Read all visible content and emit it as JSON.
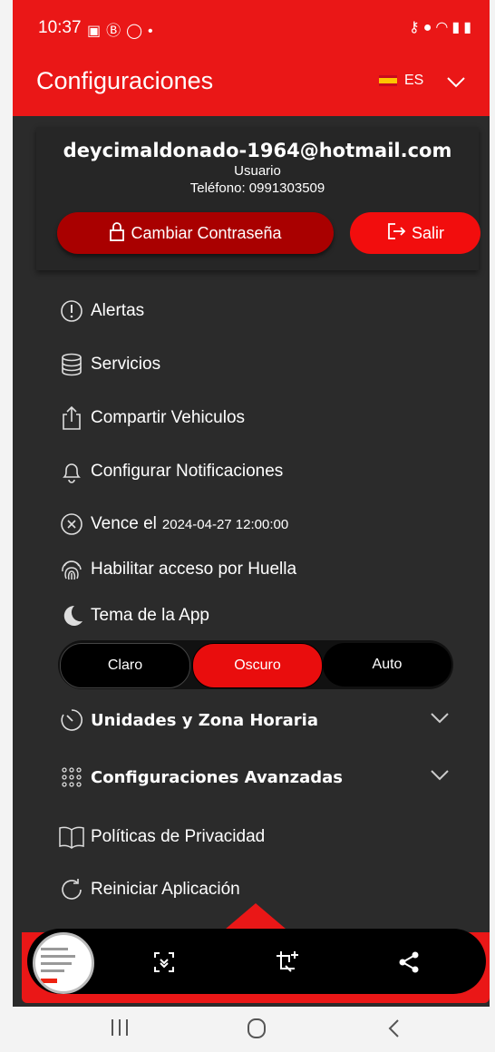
{
  "status": {
    "time": "10:37",
    "left_icons": [
      "gallery-icon",
      "b-icon",
      "whatsapp-icon",
      "dot-icon"
    ],
    "right_icons": [
      "key-icon",
      "location-icon",
      "wifi-icon",
      "lte-icon",
      "signal-icon",
      "battery-icon"
    ]
  },
  "header": {
    "title": "Configuraciones",
    "lang": "ES"
  },
  "user": {
    "email": "deycimaldonado-1964@hotmail.com",
    "role": "Usuario",
    "phone": "Teléfono: 0991303509",
    "change_password": "Cambiar Contraseña",
    "logout": "Salir"
  },
  "menu": {
    "alerts": "Alertas",
    "services": "Servicios",
    "share": "Compartir Vehiculos",
    "notifications": "Configurar Notificaciones",
    "expires_label": "Vence el",
    "expires_value": "2024-04-27 12:00:00",
    "fingerprint": "Habilitar acceso por Huella",
    "theme": "Tema de la App",
    "units": "Unidades y Zona Horaria",
    "advanced": "Configuraciones Avanzadas",
    "privacy": "Políticas de Privacidad",
    "restart": "Reiniciar Aplicación"
  },
  "theme_options": {
    "light": "Claro",
    "dark": "Oscuro",
    "auto": "Auto",
    "selected": "Oscuro"
  },
  "colors": {
    "accent": "#ea1717",
    "background": "#2b2b2b",
    "dark_button": "#a90000"
  }
}
